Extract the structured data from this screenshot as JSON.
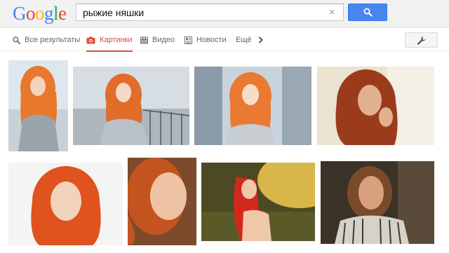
{
  "header": {
    "logo": {
      "letters": [
        "G",
        "o",
        "o",
        "g",
        "l",
        "e"
      ],
      "colors": [
        "#4285f4",
        "#ea4335",
        "#fbbc05",
        "#4285f4",
        "#34a853",
        "#ea4335"
      ]
    },
    "search": {
      "value": "рыжие няшки",
      "clear_symbol": "×",
      "button_icon": "search-icon",
      "button_color": "#4787ed"
    }
  },
  "tabs": {
    "items": [
      {
        "label": "Все результаты",
        "icon": "search-icon",
        "active": false
      },
      {
        "label": "Картинки",
        "icon": "camera-icon",
        "active": true
      },
      {
        "label": "Видео",
        "icon": "film-icon",
        "active": false
      },
      {
        "label": "Новости",
        "icon": "newspaper-icon",
        "active": false
      },
      {
        "label": "Ещё",
        "icon": "chevron-right-icon",
        "active": false
      }
    ],
    "active_color": "#dd4b39",
    "tools_icon": "wrench-icon"
  },
  "results": {
    "images": [
      {
        "description": "red-haired girl in grey coat, long orange hair",
        "accent": "#e8782b"
      },
      {
        "description": "red-haired girl on snowy bridge",
        "accent": "#e06d2a"
      },
      {
        "description": "red-haired girl with snowy background",
        "accent": "#ea7a32"
      },
      {
        "description": "auburn-haired woman, hand near face",
        "accent": "#9a3b1c"
      },
      {
        "description": "red-haired girl portrait, green eyes",
        "accent": "#e0521e"
      },
      {
        "description": "red-haired woman smiling close-up",
        "accent": "#c4541f"
      },
      {
        "description": "red-haired girl in sunset field",
        "accent": "#d2281c"
      },
      {
        "description": "long-haired man in striped shirt",
        "accent": "#7a4a2a"
      }
    ]
  }
}
